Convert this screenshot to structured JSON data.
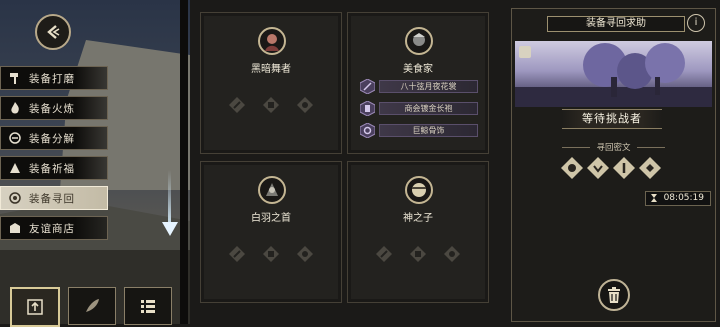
{
  "sidebar": {
    "items": [
      {
        "label": "装备打磨",
        "icon": "hammer-icon"
      },
      {
        "label": "装备火炼",
        "icon": "flame-icon"
      },
      {
        "label": "装备分解",
        "icon": "decompose-icon"
      },
      {
        "label": "装备祈福",
        "icon": "bless-icon"
      },
      {
        "label": "装备寻回",
        "icon": "retrieve-icon",
        "active": true
      },
      {
        "label": "友谊商店",
        "icon": "shop-icon"
      }
    ],
    "bottom_buttons": [
      "upload-icon",
      "feather-icon",
      "list-icon"
    ]
  },
  "cards": [
    {
      "name": "黑暗舞者",
      "items": []
    },
    {
      "name": "美食家",
      "items": [
        "八十弦月夜花裳",
        "商会镀金长袍",
        "巨鲸骨饰"
      ]
    },
    {
      "name": "白羽之首",
      "items": []
    },
    {
      "name": "神之子",
      "items": []
    }
  ],
  "panel": {
    "title": "装备寻回求助",
    "info": "i",
    "status": "等待挑战者",
    "cipher_label": "寻回密文",
    "timer": "08:05:19"
  },
  "colors": {
    "accent_gold": "#c4b693",
    "item_purple": "#5a4f6b",
    "panel_bg": "#1d1c19"
  }
}
